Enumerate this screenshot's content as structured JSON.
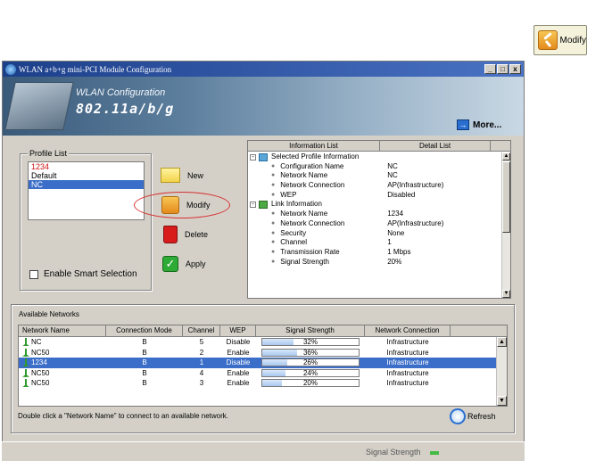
{
  "callout": {
    "label": "Modify"
  },
  "window": {
    "title": "WLAN a+b+g mini-PCI Module Configuration",
    "buttons": [
      "_",
      "□",
      "x"
    ]
  },
  "banner": {
    "subtitle": "WLAN Configuration",
    "heading": "802.11a/b/g",
    "more": "More..."
  },
  "profile": {
    "group_title": "Profile List",
    "items": [
      {
        "name": "1234",
        "style": "red"
      },
      {
        "name": "Default",
        "style": "normal"
      },
      {
        "name": "NC",
        "style": "selected"
      }
    ],
    "actions": {
      "new": "New",
      "modify": "Modify",
      "delete": "Delete",
      "apply": "Apply"
    },
    "smart_selection": "Enable Smart Selection"
  },
  "info": {
    "tabs": [
      "Information List",
      "Detail List"
    ],
    "selected_section": "Selected Profile Information",
    "selected_rows": [
      {
        "k": "Configuration Name",
        "v": "NC"
      },
      {
        "k": "Network Name",
        "v": "NC"
      },
      {
        "k": "Network Connection",
        "v": "AP(Infrastructure)"
      },
      {
        "k": "WEP",
        "v": "Disabled"
      }
    ],
    "link_section": "Link Information",
    "link_rows": [
      {
        "k": "Network Name",
        "v": "1234"
      },
      {
        "k": "Network Connection",
        "v": "AP(Infrastructure)"
      },
      {
        "k": "Security",
        "v": "None"
      },
      {
        "k": "Channel",
        "v": "1"
      },
      {
        "k": "Transmission Rate",
        "v": "1 Mbps"
      },
      {
        "k": "Signal Strength",
        "v": "20%"
      }
    ]
  },
  "networks": {
    "group_title": "Available Networks",
    "columns": [
      "Network Name",
      "Connection Mode",
      "Channel",
      "WEP",
      "Signal Strength",
      "Network Connection"
    ],
    "rows": [
      {
        "name": "NC",
        "mode": "B",
        "channel": "5",
        "wep": "Disable",
        "signal": "32%",
        "signal_pct": 32,
        "conn": "Infrastructure",
        "selected": false
      },
      {
        "name": "NC50",
        "mode": "B",
        "channel": "2",
        "wep": "Enable",
        "signal": "36%",
        "signal_pct": 36,
        "conn": "Infrastructure",
        "selected": false
      },
      {
        "name": "1234",
        "mode": "B",
        "channel": "1",
        "wep": "Disable",
        "signal": "26%",
        "signal_pct": 26,
        "conn": "Infrastructure",
        "selected": true
      },
      {
        "name": "NC50",
        "mode": "B",
        "channel": "4",
        "wep": "Enable",
        "signal": "24%",
        "signal_pct": 24,
        "conn": "Infrastructure",
        "selected": false
      },
      {
        "name": "NC50",
        "mode": "B",
        "channel": "3",
        "wep": "Enable",
        "signal": "20%",
        "signal_pct": 20,
        "conn": "Infrastructure",
        "selected": false
      }
    ],
    "hint": "Double click a \"Network Name\" to connect to an available network.",
    "refresh": "Refresh"
  },
  "status": {
    "signal": "Signal Strength"
  },
  "colors": {
    "selection": "#3a6ec8",
    "accent_red": "#d01010",
    "titlebar": "#1c3f8a"
  }
}
